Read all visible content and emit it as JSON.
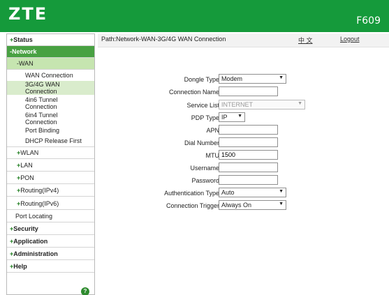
{
  "header": {
    "logo": "ZTE",
    "model": "F609"
  },
  "sidebar": {
    "status": "Status",
    "network": "-Network",
    "wan": "-WAN",
    "wan_items": [
      "WAN Connection",
      "3G/4G WAN\nConnection",
      "4in6 Tunnel\nConnection",
      "6in4 Tunnel\nConnection",
      "Port Binding",
      "DHCP Release First"
    ],
    "wlan": "WLAN",
    "lan": "LAN",
    "pon": "PON",
    "routing_ipv4": "Routing(IPv4)",
    "routing_ipv6": "Routing(IPv6)",
    "port_locating": "Port Locating",
    "security": "Security",
    "application": "Application",
    "administration": "Administration",
    "help": "Help",
    "help_icon": "?"
  },
  "pathbar": {
    "path": "Path:Network-WAN-3G/4G WAN Connection",
    "lang": "中 文",
    "logout": "Logout"
  },
  "form": {
    "dongle_type": {
      "label": "Dongle Type",
      "value": "Modem"
    },
    "connection_name": {
      "label": "Connection Name",
      "value": ""
    },
    "service_list": {
      "label": "Service List",
      "value": "INTERNET"
    },
    "pdp_type": {
      "label": "PDP Type",
      "value": "IP"
    },
    "apn": {
      "label": "APN",
      "value": ""
    },
    "dial_number": {
      "label": "Dial Number",
      "value": ""
    },
    "mtu": {
      "label": "MTU",
      "value": "1500"
    },
    "username": {
      "label": "Username",
      "value": ""
    },
    "password": {
      "label": "Password",
      "value": ""
    },
    "auth_type": {
      "label": "Authentication Type",
      "value": "Auto"
    },
    "conn_trigger": {
      "label": "Connection Trigger",
      "value": "Always On"
    }
  },
  "colors": {
    "brand_green": "#159a3b",
    "nav_green": "#48a142",
    "nav_light": "#c6e5b0"
  }
}
